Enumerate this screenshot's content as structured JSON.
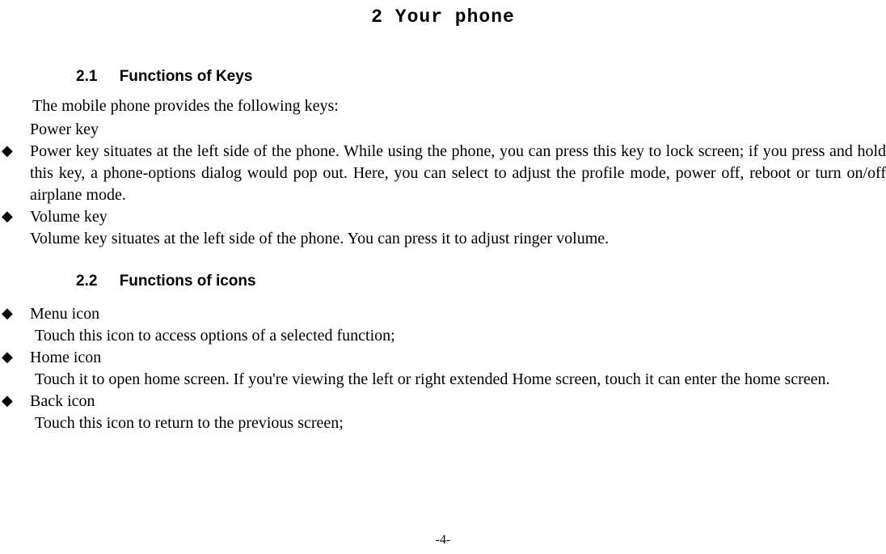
{
  "chapter": {
    "number": "2",
    "title": "Your phone"
  },
  "sections": {
    "s1": {
      "number": "2.1",
      "title": "Functions of Keys",
      "intro": "The mobile phone provides the following keys:",
      "power_label": "Power key",
      "power_desc": "Power key situates at the left side of the phone. While using the phone, you can press this key to lock screen; if you press and hold this key, a phone-options dialog would pop out. Here, you can select to adjust the profile mode, power off, reboot or turn on/off airplane mode.",
      "volume_label": "Volume key",
      "volume_desc": "Volume key situates at the left side of the phone. You can press it to adjust ringer volume."
    },
    "s2": {
      "number": "2.2",
      "title": "Functions of icons",
      "menu_label": "Menu icon",
      "menu_desc": "Touch this icon to access options of a selected function;",
      "home_label": "Home icon",
      "home_desc": "Touch it to open home screen. If you're viewing the left or right extended Home screen, touch it can enter the home screen.",
      "back_label": "Back icon",
      "back_desc": "Touch this icon to return to the previous screen;"
    }
  },
  "page_number": "-4-"
}
